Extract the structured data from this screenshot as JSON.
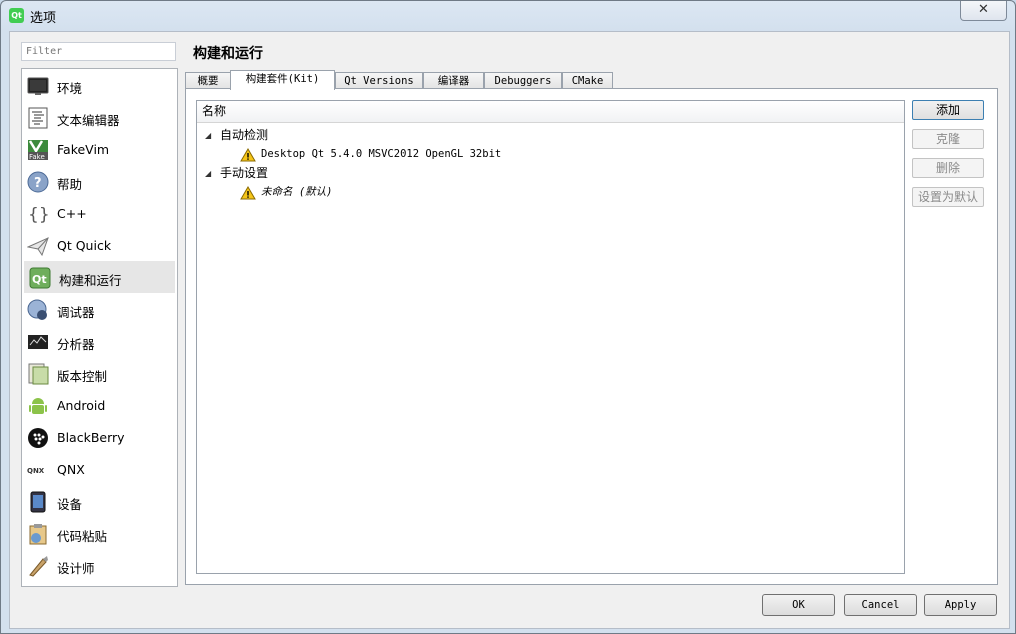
{
  "window": {
    "title": "选项",
    "close_symbol": "✕",
    "app_icon_text": "Qt"
  },
  "filter": {
    "placeholder": "Filter"
  },
  "sidebar": {
    "items": [
      {
        "label": "环境",
        "icon": "monitor-icon"
      },
      {
        "label": "文本编辑器",
        "icon": "text-editor-icon"
      },
      {
        "label": "FakeVim",
        "icon": "fakevim-icon"
      },
      {
        "label": "帮助",
        "icon": "help-icon"
      },
      {
        "label": "C++",
        "icon": "braces-icon"
      },
      {
        "label": "Qt Quick",
        "icon": "paper-plane-icon"
      },
      {
        "label": "构建和运行",
        "icon": "build-run-icon",
        "selected": true
      },
      {
        "label": "调试器",
        "icon": "debugger-icon"
      },
      {
        "label": "分析器",
        "icon": "analyzer-icon"
      },
      {
        "label": "版本控制",
        "icon": "version-control-icon"
      },
      {
        "label": "Android",
        "icon": "android-icon"
      },
      {
        "label": "BlackBerry",
        "icon": "blackberry-icon"
      },
      {
        "label": "QNX",
        "icon": "qnx-icon"
      },
      {
        "label": "设备",
        "icon": "device-icon"
      },
      {
        "label": "代码粘贴",
        "icon": "code-paste-icon"
      },
      {
        "label": "设计师",
        "icon": "designer-icon"
      }
    ]
  },
  "page": {
    "title": "构建和运行"
  },
  "tabs": [
    {
      "label": "概要"
    },
    {
      "label": "构建套件(Kit)",
      "active": true
    },
    {
      "label": "Qt Versions"
    },
    {
      "label": "编译器"
    },
    {
      "label": "Debuggers"
    },
    {
      "label": "CMake"
    }
  ],
  "kits": {
    "column_header": "名称",
    "groups": [
      {
        "label": "自动检测",
        "items": [
          {
            "label": "Desktop Qt 5.4.0 MSVC2012 OpenGL 32bit"
          }
        ]
      },
      {
        "label": "手动设置",
        "items": [
          {
            "label": "未命名 (默认)"
          }
        ]
      }
    ]
  },
  "actions": {
    "add": "添加",
    "clone": "克隆",
    "remove": "删除",
    "make_default": "设置为默认"
  },
  "dialog": {
    "ok": "OK",
    "cancel": "Cancel",
    "apply": "Apply"
  },
  "colors": {
    "warning": "#f5c518",
    "selected_item_bg": "#e6e6e6",
    "qt_green": "#41cd52"
  }
}
